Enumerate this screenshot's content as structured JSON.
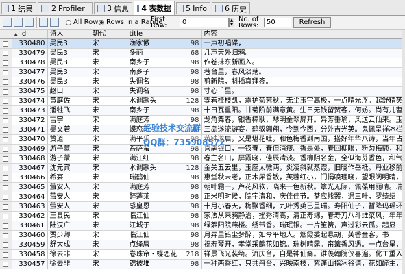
{
  "tabs": [
    {
      "num": "1",
      "label": "结果",
      "icon": "result-icon"
    },
    {
      "num": "2",
      "label": "Profiler",
      "icon": "profiler-icon"
    },
    {
      "num": "3",
      "label": "信息",
      "icon": "info-icon"
    },
    {
      "num": "4",
      "label": "表数据",
      "icon": "table-data-icon"
    },
    {
      "num": "5",
      "label": "Info",
      "icon": "info-icon"
    },
    {
      "num": "6",
      "label": "历史",
      "icon": "history-icon"
    }
  ],
  "active_tab": "表数据",
  "toolbar": {
    "all_rows_label": "All Rows",
    "rows_in_range_label": "Rows in a Range",
    "first_row_label": "First Row:",
    "first_row_value": "0",
    "no_of_rows_label": "No. of Rows:",
    "no_of_rows_value": "50",
    "refresh_label": "Refresh"
  },
  "columns": [
    "id",
    "诗人",
    "朝代",
    "title",
    "",
    "内容"
  ],
  "rows": [
    {
      "id": "330480",
      "poet": "吴民3",
      "dynasty": "宋",
      "title": "渔家傲",
      "size": "98",
      "content": "一声初唱碟，"
    },
    {
      "id": "330479",
      "poet": "吴民3",
      "dynasty": "宋",
      "title": "多丽",
      "size": "68",
      "content": "几声天外归鸦。"
    },
    {
      "id": "330478",
      "poet": "吴民3",
      "dynasty": "宋",
      "title": "南乡子",
      "size": "98",
      "content": "作卷抹东新画入。"
    },
    {
      "id": "330477",
      "poet": "吴民3",
      "dynasty": "宋",
      "title": "南乡子",
      "size": "98",
      "content": "巷台里，春风淡荡。"
    },
    {
      "id": "330476",
      "poet": "吴民3",
      "dynasty": "宋",
      "title": "失调名",
      "size": "98",
      "content": "剪新院，斜插真拜签。"
    },
    {
      "id": "330475",
      "poet": "赵口",
      "dynasty": "宋",
      "title": "失调名",
      "size": "98",
      "content": "寸心千里。"
    },
    {
      "id": "330474",
      "poet": "黄庭佐",
      "dynasty": "宋",
      "title": "水调歌头",
      "size": "128",
      "content": "霎着桂枝凯，霜护菊萦秋。无尘玉宇高极，一点晴光浮。起舒精芙"
    },
    {
      "id": "330473",
      "poet": "潘牲飞",
      "dynasty": "宋",
      "title": "南乡子",
      "size": "98",
      "content": "十日瓦重阳。甘菊阶前满意黄。生日无钱留贺客，何妨。尚有儿曹"
    },
    {
      "id": "330472",
      "poet": "吉宇",
      "dynasty": "宋",
      "title": "满庭芳",
      "size": "98",
      "content": "龙角舞春，银香棒耿，琴明金翠屏开。异芳垂瑜，风送云仙来。玉"
    },
    {
      "id": "330471",
      "poet": "吴文若",
      "dynasty": "宋",
      "title": "蝶恋花",
      "size": "98",
      "content": "三岛遂流游宴，鹤驭翱翔，今到今西，分外吉光英。鬼佩呈祥冰栏，广寨仙"
    },
    {
      "id": "330470",
      "poet": "赞道",
      "dynasty": "宋",
      "title": "满平乐",
      "size": "98",
      "content": "黄钟遂启，又是堪花吐，和色梅香到南国，搭好年华八诗，当年占"
    },
    {
      "id": "330469",
      "poet": "游子蒙",
      "dynasty": "宋",
      "title": "菩萨蛮",
      "size": "98",
      "content": "喜鹊银口，一钗春，春但消瘦。香是处，春回柳眼，粉匀梅额，和"
    },
    {
      "id": "330468",
      "poet": "游子蒙",
      "dynasty": "宋",
      "title": "满江红",
      "size": "98",
      "content": "春主名山，屏霞晓，佳辰清淡。香柳阴名金，全似海芬香色，和气"
    },
    {
      "id": "330467",
      "poet": "沈元宾",
      "dynasty": "宋",
      "title": "水调歌头",
      "size": "128",
      "content": "金关五云里，玉座太微两，炎凌斜就蒸霞，旧晓作岳祗。丹业移前"
    },
    {
      "id": "330466",
      "poet": "希宴",
      "dynasty": "宋",
      "title": "瑞鹤仙",
      "size": "98",
      "content": "惠堂秋未老，正木犀香散，芙蓉红小，门捐嗅理晓，望眼阔明晴，"
    },
    {
      "id": "330465",
      "poet": "萤安人",
      "dynasty": "宋",
      "title": "满庭芳",
      "size": "98",
      "content": "朝叶霜干，芦花风软，晓来一色新秋。簟光无际，佩葆用丽晴。瑞"
    },
    {
      "id": "330464",
      "poet": "萤安人",
      "dynasty": "宋",
      "title": "醉蓬莱",
      "size": "98",
      "content": "正米明时候，院宇清和，庆佳佳节。梦应熊罴，遇三叶，罗绮绍"
    },
    {
      "id": "330463",
      "poet": "萤安人",
      "dynasty": "宋",
      "title": "感皇恩",
      "size": "98",
      "content": "十月小春天，梅飘香细，九叶秀萸已呈瑞。寿阳仙子，暂降玛瑶环"
    },
    {
      "id": "330462",
      "poet": "王县民",
      "dynasty": "宋",
      "title": "临江仙",
      "size": "98",
      "content": "家法从来鸦静治，挫秀清高，清正寿绵，春寿刀八斗维菜风，年年正月尾，"
    },
    {
      "id": "330461",
      "poet": "陆汉广",
      "dynasty": "宋",
      "title": "江城子",
      "size": "98",
      "content": "绿絮阳院燕楼。绣带香。瑞珉银。一片笙簧，声过彩云孤。起显"
    },
    {
      "id": "330460",
      "poet": "贾少卿",
      "dynasty": "宋",
      "title": "临江仙",
      "size": "98",
      "content": "月弄里铅尘梦醉，如今平地人。烟霞委起悬胡，芙香金客，书"
    },
    {
      "id": "330459",
      "poet": "舒大成",
      "dynasty": "宋",
      "title": "点绛唇",
      "size": "98",
      "content": "祝寿琴开，孝堂采麟花如锦。瑞树晴露。帘篝香风遇。一点台星，"
    },
    {
      "id": "330458",
      "poet": "徐去非",
      "dynasty": "宋",
      "title": "卷珠帘・蝶恋花",
      "size": "218",
      "content": "祥景飞光装绮。流庆台，自是神仙裔。谁羡翰院仪喜遍。化工重入"
    },
    {
      "id": "330457",
      "poet": "徐去非",
      "dynasty": "宋",
      "title": "锦被堆",
      "size": "98",
      "content": "一种两香红，只共丹台，兴映南枝，紫蓬山指冰谷请，花如醉主，香"
    }
  ],
  "watermark": {
    "line1": "经验技术交流群",
    "line2": "QQ群：735908572"
  }
}
